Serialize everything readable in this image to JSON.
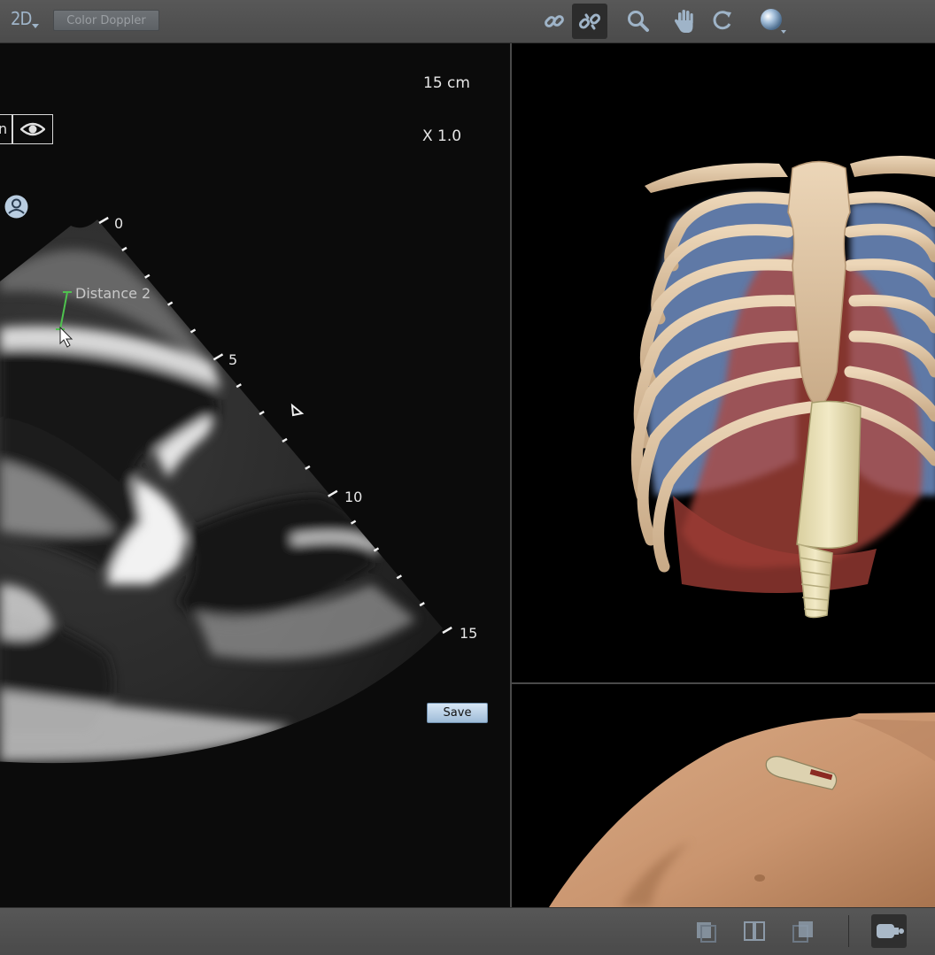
{
  "toolbar": {
    "mode_label": "2D",
    "color_doppler_label": "Color Doppler",
    "tools": [
      "link-icon",
      "unlink-icon",
      "magnify-icon",
      "pan-hand-icon",
      "rotate-icon",
      "sphere-icon"
    ],
    "active_tool": "unlink-icon"
  },
  "ultrasound": {
    "depth_label": "15 cm",
    "zoom_label": "X 1.0",
    "cut_button_label": "n",
    "measurement_label": "Distance 2",
    "scale_labels": [
      "0",
      "5",
      "10",
      "15"
    ],
    "save_label": "Save"
  },
  "bottombar": {
    "buttons": [
      "layout-left-icon",
      "layout-split-icon",
      "layout-right-icon",
      "probe-view-icon"
    ],
    "active_button": "probe-view-icon"
  },
  "colors": {
    "toolbar_bg": "#555555",
    "panel_bg": "#0b0b0b",
    "icon_blue": "#9fb4c8",
    "measure_green": "#4ec24e",
    "bone": "#dcc3a2",
    "lung": "#6f8fc4",
    "heart": "#b0473e",
    "skin": "#cf9f7b",
    "probe": "#e6dcb0"
  }
}
